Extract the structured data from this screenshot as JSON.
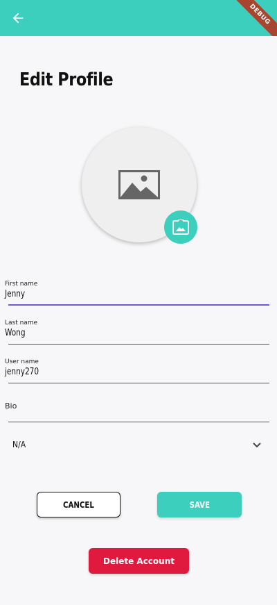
{
  "app_bar": {
    "back_icon": "arrow-left-icon",
    "debug_label": "DEBUG",
    "color": "#3dcfbe"
  },
  "page": {
    "title": "Edit Profile"
  },
  "avatar": {
    "placeholder_icon": "image-placeholder-icon",
    "camera_icon": "camera-photo-icon"
  },
  "form": {
    "first_name": {
      "label": "First name",
      "value": "Jenny"
    },
    "last_name": {
      "label": "Last name",
      "value": "Wong"
    },
    "user_name": {
      "label": "User name",
      "value": "jenny270"
    },
    "bio": {
      "label": "Bio",
      "value": ""
    },
    "dropdown": {
      "selected": "N/A",
      "icon": "chevron-down-icon"
    }
  },
  "actions": {
    "cancel_label": "CANCEL",
    "save_label": "SAVE",
    "delete_label": "Delete Account"
  },
  "colors": {
    "accent": "#3dcfbe",
    "danger": "#e0193f",
    "focus_underline": "#6b5fd3"
  }
}
